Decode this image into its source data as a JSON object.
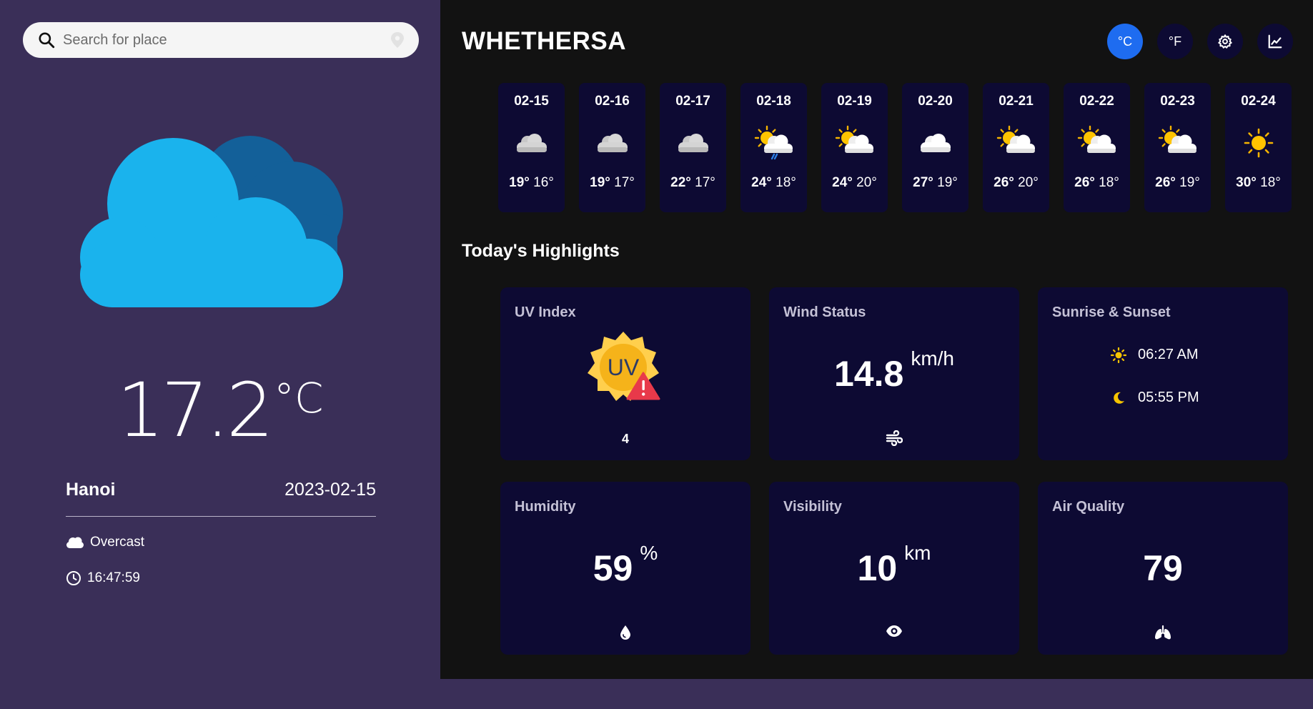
{
  "search": {
    "placeholder": "Search for place"
  },
  "current": {
    "temperature": "17.2",
    "unit": "°C",
    "city": "Hanoi",
    "date": "2023-02-15",
    "condition": "Overcast",
    "time": "16:47:59"
  },
  "app": {
    "title": "WHETHERSA"
  },
  "toolbar": {
    "celsius_label": "°C",
    "fahrenheit_label": "°F"
  },
  "forecast": [
    {
      "date": "02-15",
      "max": "19°",
      "min": "16°",
      "icon": "cloud-icon"
    },
    {
      "date": "02-16",
      "max": "19°",
      "min": "17°",
      "icon": "cloud-icon"
    },
    {
      "date": "02-17",
      "max": "22°",
      "min": "17°",
      "icon": "cloud-icon"
    },
    {
      "date": "02-18",
      "max": "24°",
      "min": "18°",
      "icon": "sun-cloud-rain-icon"
    },
    {
      "date": "02-19",
      "max": "24°",
      "min": "20°",
      "icon": "sun-cloud-icon"
    },
    {
      "date": "02-20",
      "max": "27°",
      "min": "19°",
      "icon": "cloud-icon"
    },
    {
      "date": "02-21",
      "max": "26°",
      "min": "20°",
      "icon": "sun-cloud-icon"
    },
    {
      "date": "02-22",
      "max": "26°",
      "min": "18°",
      "icon": "sun-cloud-icon"
    },
    {
      "date": "02-23",
      "max": "26°",
      "min": "19°",
      "icon": "sun-cloud-icon"
    },
    {
      "date": "02-24",
      "max": "30°",
      "min": "18°",
      "icon": "sun-icon"
    }
  ],
  "highlights": {
    "title": "Today's Highlights",
    "uv": {
      "title": "UV Index",
      "badge": "UV",
      "value": "4"
    },
    "wind": {
      "title": "Wind Status",
      "value": "14.8",
      "unit": "km/h"
    },
    "sun": {
      "title": "Sunrise & Sunset",
      "sunrise": "06:27 AM",
      "sunset": "05:55 PM"
    },
    "humidity": {
      "title": "Humidity",
      "value": "59",
      "unit": "%"
    },
    "visibility": {
      "title": "Visibility",
      "value": "10",
      "unit": "km"
    },
    "air": {
      "title": "Air Quality",
      "value": "79"
    }
  },
  "colors": {
    "left_bg": "#3a2f58",
    "right_bg": "#121212",
    "card_bg": "#0d0a33",
    "accent": "#1e6cf0",
    "cloud_front": "#1ab3ed",
    "cloud_back": "#136099"
  }
}
